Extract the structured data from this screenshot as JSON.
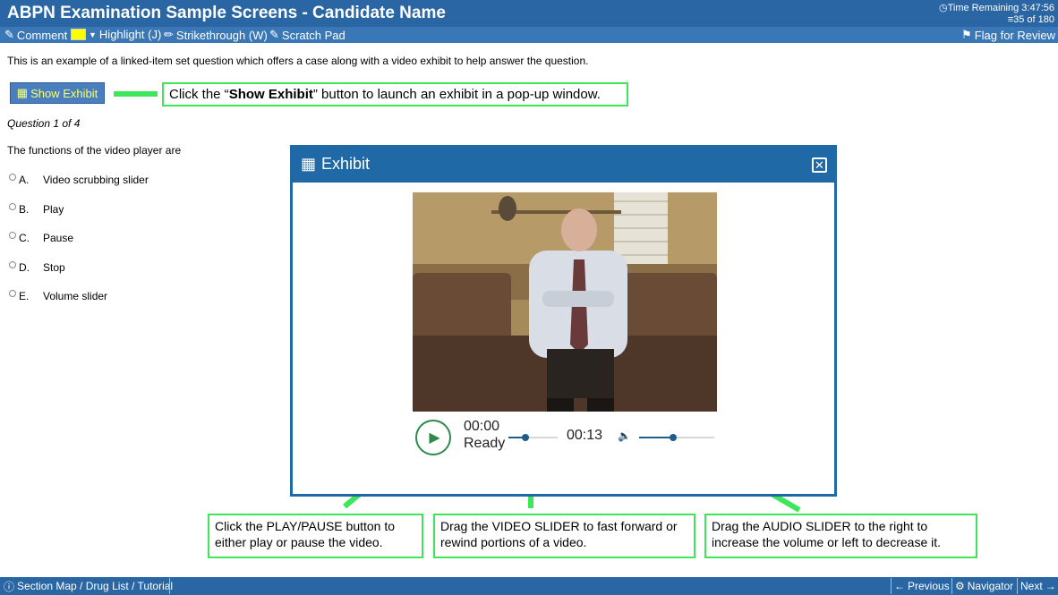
{
  "header": {
    "title": "ABPN Examination Sample Screens - Candidate Name",
    "time_remaining": "Time Remaining 3:47:56",
    "question_count": "35 of 180"
  },
  "toolbar": {
    "comment": "Comment",
    "highlight": "Highlight (J)",
    "strikethrough": "Strikethrough (W)",
    "scratch_pad": "Scratch Pad",
    "flag": "Flag for Review",
    "highlight_color": "#ffff00"
  },
  "main": {
    "intro": "This is an example of a linked-item set question which offers a case along with a video exhibit to help answer the question.",
    "show_exhibit": "Show Exhibit",
    "question_number": "Question 1 of 4",
    "stem": "The functions of the video player are",
    "options": [
      {
        "letter": "A.",
        "text": "Video scrubbing slider"
      },
      {
        "letter": "B.",
        "text": "Play"
      },
      {
        "letter": "C.",
        "text": "Pause"
      },
      {
        "letter": "D.",
        "text": "Stop"
      },
      {
        "letter": "E.",
        "text": "Volume slider"
      }
    ]
  },
  "callouts": {
    "show_exhibit_pre": "Click the “",
    "show_exhibit_bold": "Show Exhibit",
    "show_exhibit_post": "” button to launch an exhibit in a pop-up window.",
    "play": "Click the PLAY/PAUSE button to either play or pause the video.",
    "video_slider": "Drag the VIDEO SLIDER to fast forward or rewind portions of a video.",
    "audio_slider": "Drag the AUDIO SLIDER to the right to increase the volume or left to decrease it."
  },
  "exhibit": {
    "title": "Exhibit",
    "current_time": "00:00",
    "status": "Ready",
    "duration": "00:13",
    "video_progress": 0.35,
    "volume_level": 0.45
  },
  "footer": {
    "section_map": "Section Map / Drug List / Tutorial",
    "previous": "Previous",
    "navigator": "Navigator",
    "next": "Next"
  },
  "colors": {
    "header": "#2a66a3",
    "toolbar": "#3a77b6",
    "callout_border": "#3ee65a",
    "dialog": "#1f69a6",
    "play": "#2d8a4a"
  }
}
